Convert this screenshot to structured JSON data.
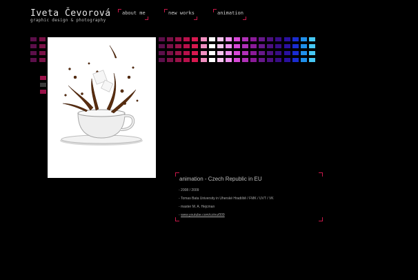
{
  "header": {
    "name": "Iveta Čevorová",
    "tagline": "graphic design & photography"
  },
  "nav": [
    {
      "label": "about me"
    },
    {
      "label": "new works"
    },
    {
      "label": "animation"
    }
  ],
  "palette": {
    "accent": "#c9184a",
    "top_grid_colors": [
      "#5c0f4a",
      "#7a1147",
      "#9a1148",
      "#b8104b",
      "#d8184f",
      "#f08ec0",
      "#ffffff",
      "#f7c6ef",
      "#f090f0",
      "#d848d8",
      "#b030b8",
      "#8a1a98",
      "#66188a",
      "#4c1080",
      "#380c86",
      "#2a10a0",
      "#1a2cd0",
      "#1f8fea",
      "#46c8f4"
    ],
    "side_colors": [
      "#5c0f4a",
      "#7a1147"
    ],
    "small_column_colors": [
      "#9a1148",
      "#3a3a3a",
      "#9a1148"
    ]
  },
  "info": {
    "title": "animation - Czech Republic in EU",
    "lines": [
      "- 2008 / 2009",
      "- Tomas Bata University in Uherské Hradiště / FMK / UVT / VK",
      "- master M. A. Hejcman"
    ],
    "link_prefix": "- ",
    "link_text": "www.youtube.com/cz/eu/009"
  }
}
